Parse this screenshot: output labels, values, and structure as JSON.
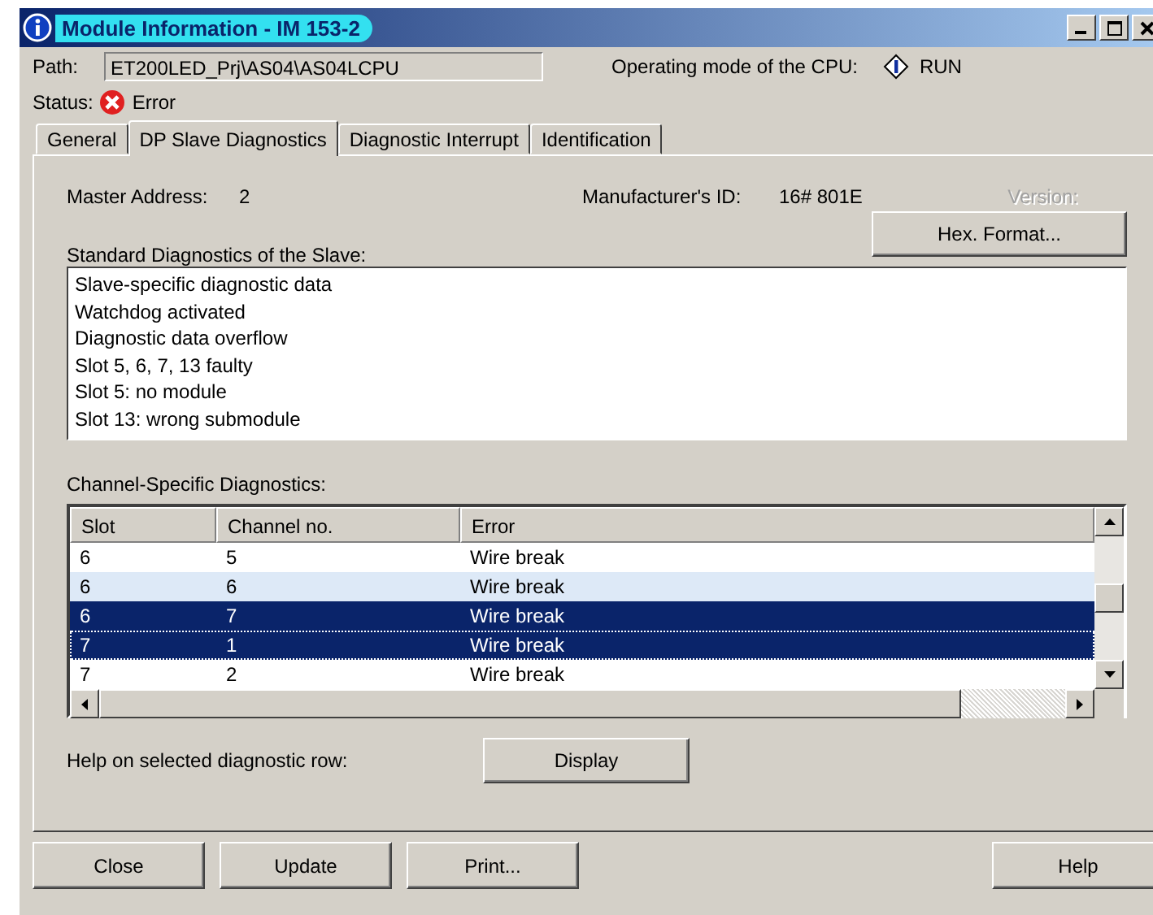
{
  "window": {
    "title": "Module Information - IM 153-2"
  },
  "path": {
    "label": "Path:",
    "value": "ET200LED_Prj\\AS04\\AS04LCPU"
  },
  "operating_mode": {
    "label": "Operating mode of the  CPU:",
    "value": "RUN"
  },
  "status": {
    "label": "Status:",
    "value": "Error"
  },
  "tabs": [
    {
      "label": "General",
      "selected": false
    },
    {
      "label": "DP Slave Diagnostics",
      "selected": true
    },
    {
      "label": "Diagnostic Interrupt",
      "selected": false
    },
    {
      "label": "Identification",
      "selected": false
    }
  ],
  "master_address": {
    "label": "Master Address:",
    "value": "2"
  },
  "manufacturer_id": {
    "label": "Manufacturer's ID:",
    "value": "16# 801E"
  },
  "version": {
    "label": "Version:",
    "disabled": true
  },
  "hex_button": "Hex. Format...",
  "standard_diagnostics": {
    "label": "Standard Diagnostics of the Slave:",
    "items": [
      "Slave-specific diagnostic data",
      "Watchdog activated",
      "Diagnostic data overflow",
      "Slot 5, 6, 7, 13 faulty",
      "Slot 5: no module",
      "Slot 13: wrong submodule"
    ]
  },
  "channel_diagnostics": {
    "label": "Channel-Specific Diagnostics:",
    "columns": [
      "Slot",
      "Channel no.",
      "Error"
    ],
    "rows": [
      {
        "cells": [
          "6",
          "5",
          "Wire break"
        ],
        "selected": false,
        "highlighted": false,
        "focused": false
      },
      {
        "cells": [
          "6",
          "6",
          "Wire break"
        ],
        "selected": false,
        "highlighted": true,
        "focused": false
      },
      {
        "cells": [
          "6",
          "7",
          "Wire break"
        ],
        "selected": true,
        "highlighted": false,
        "focused": false
      },
      {
        "cells": [
          "7",
          "1",
          "Wire break"
        ],
        "selected": true,
        "highlighted": false,
        "focused": true
      },
      {
        "cells": [
          "7",
          "2",
          "Wire break"
        ],
        "selected": false,
        "highlighted": false,
        "focused": false
      }
    ]
  },
  "help_row": {
    "label": "Help on selected diagnostic row:",
    "button": "Display"
  },
  "buttons": [
    "Close",
    "Update",
    "Print..."
  ],
  "help_button": "Help"
}
